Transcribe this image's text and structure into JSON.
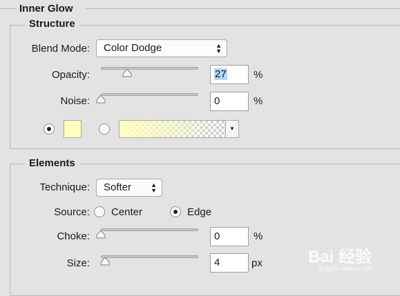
{
  "panel": {
    "title": "Inner Glow",
    "structure": {
      "title": "Structure",
      "blend_mode_label": "Blend Mode:",
      "blend_mode_value": "Color Dodge",
      "opacity_label": "Opacity:",
      "opacity_value": "27",
      "opacity_unit": "%",
      "opacity_fraction": 0.27,
      "noise_label": "Noise:",
      "noise_value": "0",
      "noise_unit": "%",
      "noise_fraction": 0.0,
      "color_swatch": "#ffffbe",
      "gradient_start": "#ffffbe",
      "solid_color_selected": true
    },
    "elements": {
      "title": "Elements",
      "technique_label": "Technique:",
      "technique_value": "Softer",
      "source_label": "Source:",
      "source_options": [
        "Center",
        "Edge"
      ],
      "source_selected": "Edge",
      "choke_label": "Choke:",
      "choke_value": "0",
      "choke_unit": "%",
      "size_label": "Size:",
      "size_value": "4",
      "size_unit": "px"
    }
  },
  "watermark": {
    "main": "Bai 经验",
    "sub": "jingyan.baidu.com"
  }
}
